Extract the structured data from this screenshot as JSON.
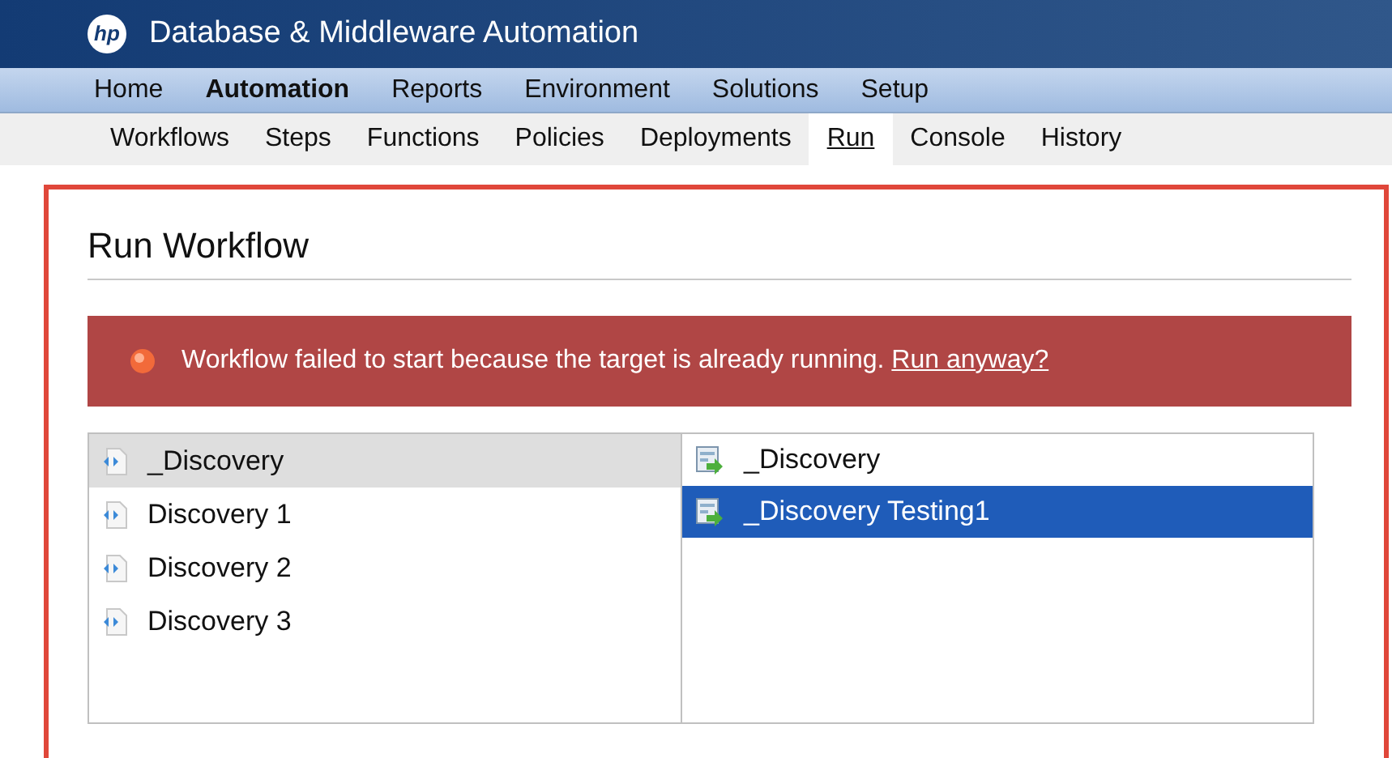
{
  "header": {
    "logo": "hp",
    "title": "Database & Middleware Automation"
  },
  "nav": [
    {
      "label": "Home",
      "selected": false
    },
    {
      "label": "Automation",
      "selected": true
    },
    {
      "label": "Reports",
      "selected": false
    },
    {
      "label": "Environment",
      "selected": false
    },
    {
      "label": "Solutions",
      "selected": false
    },
    {
      "label": "Setup",
      "selected": false
    }
  ],
  "subnav": [
    {
      "label": "Workflows",
      "selected": false
    },
    {
      "label": "Steps",
      "selected": false
    },
    {
      "label": "Functions",
      "selected": false
    },
    {
      "label": "Policies",
      "selected": false
    },
    {
      "label": "Deployments",
      "selected": false
    },
    {
      "label": "Run",
      "selected": true
    },
    {
      "label": "Console",
      "selected": false
    },
    {
      "label": "History",
      "selected": false
    }
  ],
  "page_title": "Run Workflow",
  "alert": {
    "message": "Workflow failed to start because the target is already running.",
    "link": "Run anyway?"
  },
  "workflows": [
    {
      "label": "_Discovery",
      "selected": true
    },
    {
      "label": "Discovery 1",
      "selected": false
    },
    {
      "label": "Discovery 2",
      "selected": false
    },
    {
      "label": "Discovery 3",
      "selected": false
    }
  ],
  "targets": [
    {
      "label": "_Discovery",
      "selected": false
    },
    {
      "label": "_Discovery Testing1",
      "selected": true
    }
  ]
}
